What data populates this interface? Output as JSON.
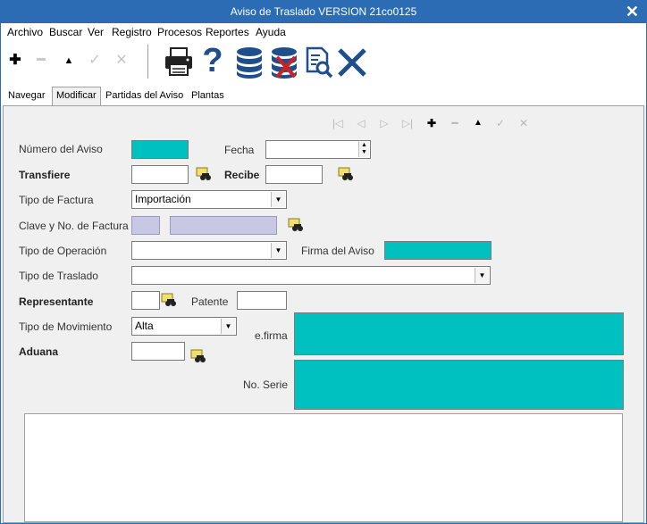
{
  "window": {
    "title": "Aviso de Traslado  VERSION 21co0125",
    "close": "✕"
  },
  "menu": [
    "Archivo",
    "Buscar",
    "Ver",
    "Registro",
    "Procesos",
    "Reportes",
    "Ayuda"
  ],
  "toolbar": {
    "add": "✚",
    "remove": "━",
    "up": "▲",
    "confirm": "✓",
    "cancel": "✕",
    "help": "?"
  },
  "tabs": [
    "Navegar",
    "Modificar",
    "Partidas del Aviso",
    "Plantas"
  ],
  "active_tab": "Modificar",
  "record_nav": {
    "first": "|◁",
    "prev": "◁",
    "next": "▷",
    "last": "▷|",
    "add": "✚",
    "remove": "━",
    "up": "▲",
    "confirm": "✓",
    "cancel": "✕"
  },
  "form": {
    "numero_aviso": {
      "label": "Número del Aviso",
      "value": ""
    },
    "fecha": {
      "label": "Fecha",
      "value": ""
    },
    "transfiere": {
      "label": "Transfiere",
      "value": ""
    },
    "recibe": {
      "label": "Recibe",
      "value": ""
    },
    "tipo_factura": {
      "label": "Tipo de Factura",
      "value": "Importación"
    },
    "clave_factura": {
      "label": "Clave y No. de Factura",
      "clave": "",
      "numero": ""
    },
    "tipo_operacion": {
      "label": "Tipo de Operación",
      "value": ""
    },
    "firma_aviso": {
      "label": "Firma del Aviso",
      "value": ""
    },
    "tipo_traslado": {
      "label": "Tipo de Traslado",
      "value": ""
    },
    "representante": {
      "label": "Representante",
      "value": ""
    },
    "patente": {
      "label": "Patente",
      "value": ""
    },
    "tipo_movimiento": {
      "label": "Tipo de Movimiento",
      "value": "Alta"
    },
    "efirma": {
      "label": "e.firma",
      "value": ""
    },
    "aduana": {
      "label": "Aduana",
      "value": ""
    },
    "no_serie": {
      "label": "No. Serie",
      "value": ""
    }
  },
  "colors": {
    "titlebar": "#2b6cb4",
    "teal_field": "#00c0c0",
    "lavender_field": "#c8c8e4",
    "icon_blue": "#1f4e8c"
  }
}
